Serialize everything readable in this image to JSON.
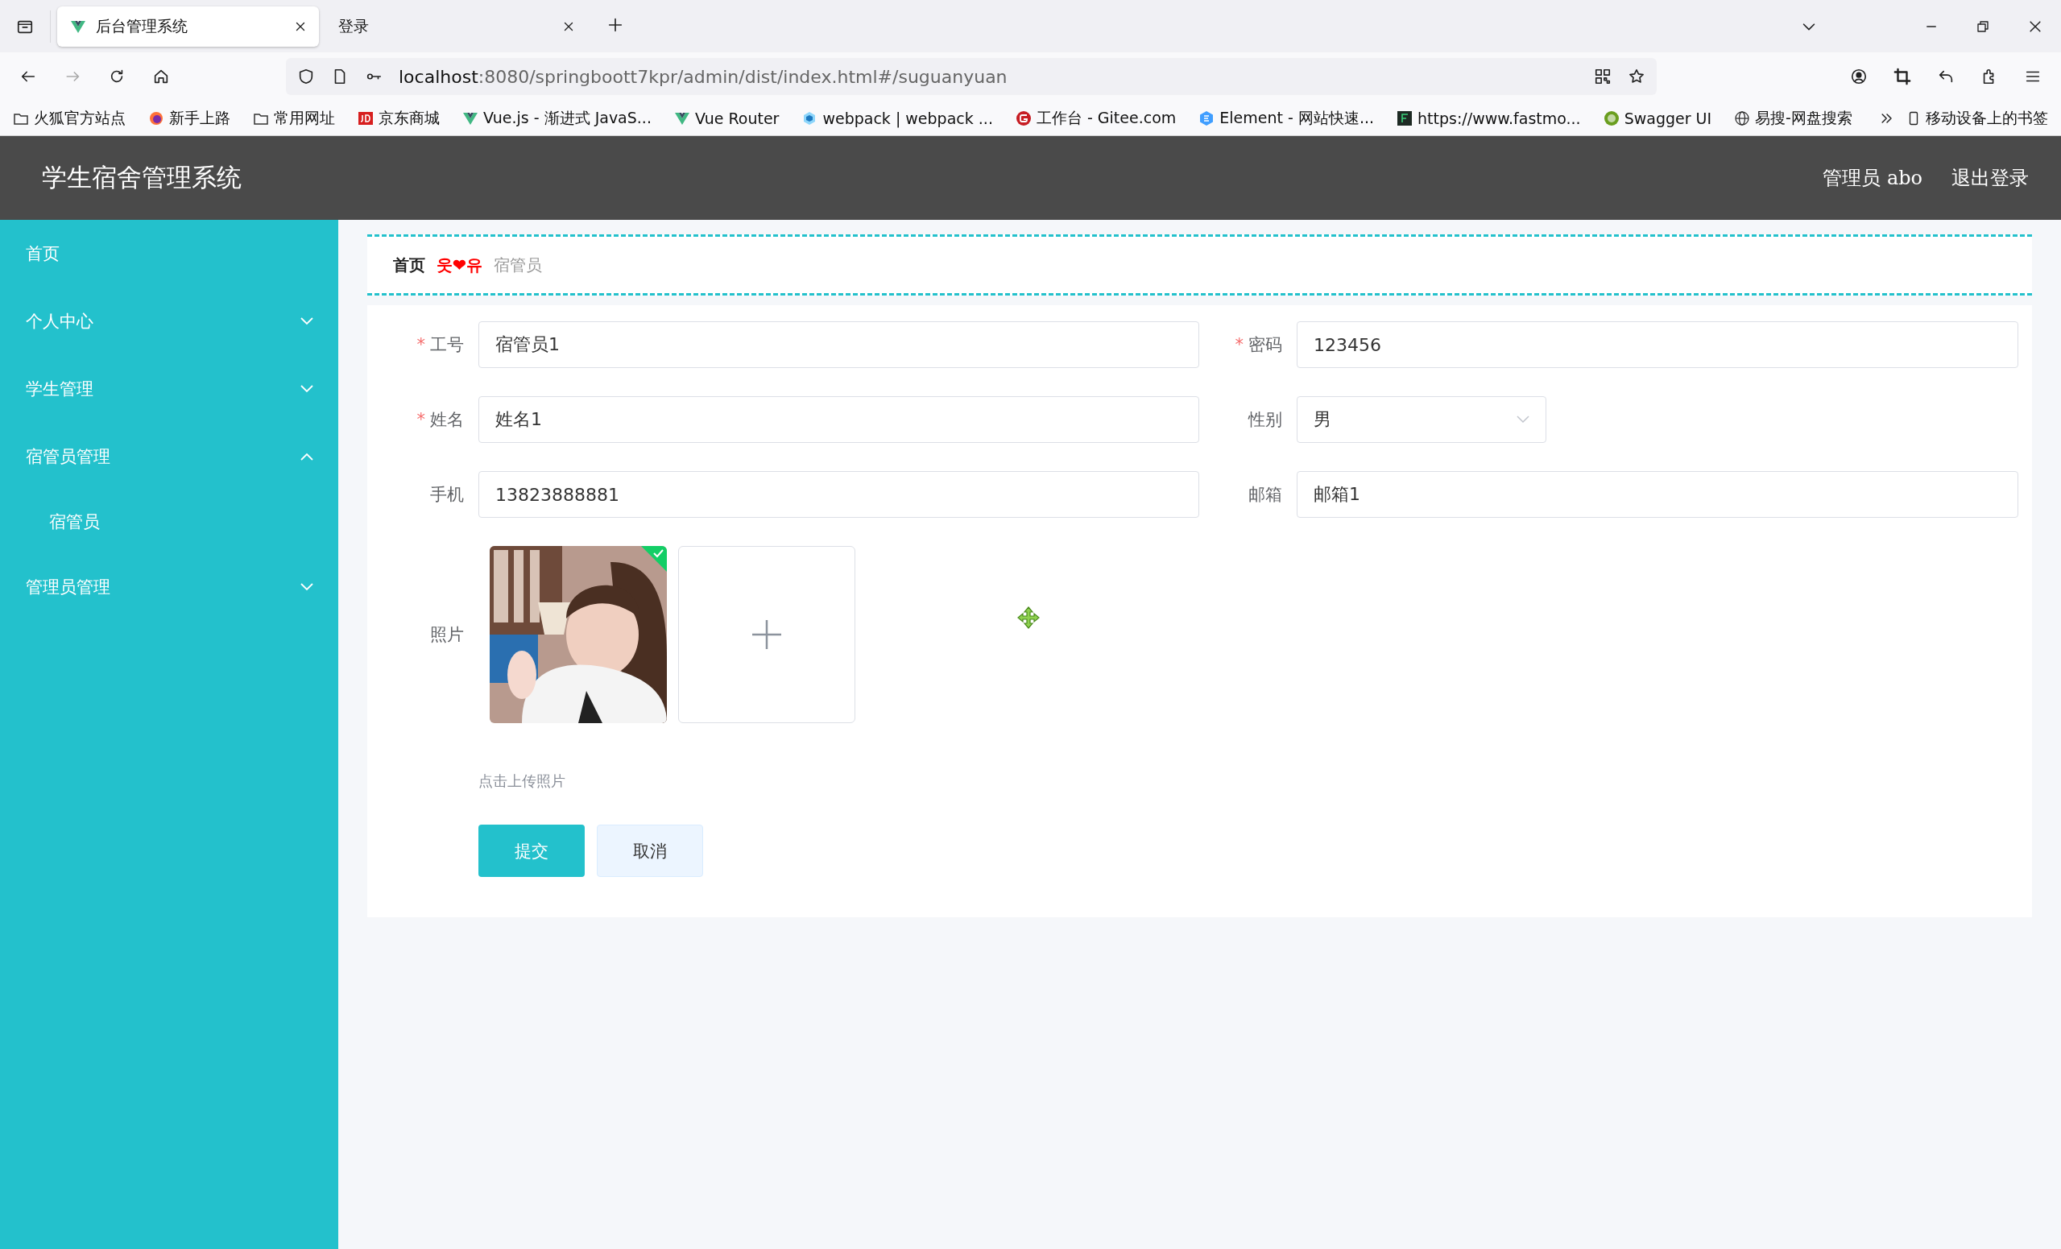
{
  "browser": {
    "tabs": [
      {
        "title": "后台管理系统",
        "selected": true
      },
      {
        "title": "登录",
        "selected": false
      }
    ],
    "url_host": "localhost",
    "url_path": ":8080/springboott7kpr/admin/dist/index.html#/suguanyuan",
    "bookmarks": [
      {
        "label": "火狐官方站点",
        "kind": "folder"
      },
      {
        "label": "新手上路",
        "kind": "fox"
      },
      {
        "label": "常用网址",
        "kind": "folder"
      },
      {
        "label": "京东商城",
        "kind": "jd"
      },
      {
        "label": "Vue.js - 渐进式 JavaS...",
        "kind": "vue"
      },
      {
        "label": "Vue Router",
        "kind": "vue"
      },
      {
        "label": "webpack | webpack ...",
        "kind": "cube"
      },
      {
        "label": "工作台 - Gitee.com",
        "kind": "gitee"
      },
      {
        "label": "Element - 网站快速...",
        "kind": "element"
      },
      {
        "label": "https://www.fastmo...",
        "kind": "fastmock"
      },
      {
        "label": "Swagger UI",
        "kind": "swagger"
      },
      {
        "label": "易搜-网盘搜索",
        "kind": "globe"
      }
    ],
    "mobile_bookmarks": "移动设备上的书签"
  },
  "header": {
    "title": "学生宿舍管理系统",
    "user": "管理员 abo",
    "logout": "退出登录"
  },
  "sidebar": {
    "items": [
      {
        "label": "首页",
        "kind": "link"
      },
      {
        "label": "个人中心",
        "kind": "menu",
        "expanded": false
      },
      {
        "label": "学生管理",
        "kind": "menu",
        "expanded": false
      },
      {
        "label": "宿管员管理",
        "kind": "menu",
        "expanded": true,
        "children": [
          {
            "label": "宿管员"
          }
        ]
      },
      {
        "label": "管理员管理",
        "kind": "menu",
        "expanded": false
      }
    ]
  },
  "breadcrumb": {
    "items": [
      "首页",
      "宿管员"
    ],
    "separator": "웃❤유"
  },
  "form": {
    "fields": [
      {
        "label": "工号",
        "required": true,
        "kind": "input",
        "value": "宿管员1"
      },
      {
        "label": "密码",
        "required": true,
        "kind": "input",
        "value": "123456"
      },
      {
        "label": "姓名",
        "required": true,
        "kind": "input",
        "value": "姓名1"
      },
      {
        "label": "性别",
        "required": false,
        "kind": "select",
        "value": "男"
      },
      {
        "label": "手机",
        "required": false,
        "kind": "input",
        "value": "13823888881"
      },
      {
        "label": "邮箱",
        "required": false,
        "kind": "input",
        "value": "邮箱1"
      }
    ],
    "required_mark": "*",
    "photo": {
      "label": "照片",
      "uploaded": true,
      "hint": "点击上传照片"
    },
    "buttons": [
      {
        "label": "提交",
        "kind": "primary"
      },
      {
        "label": "取消",
        "kind": "secondary"
      }
    ]
  }
}
